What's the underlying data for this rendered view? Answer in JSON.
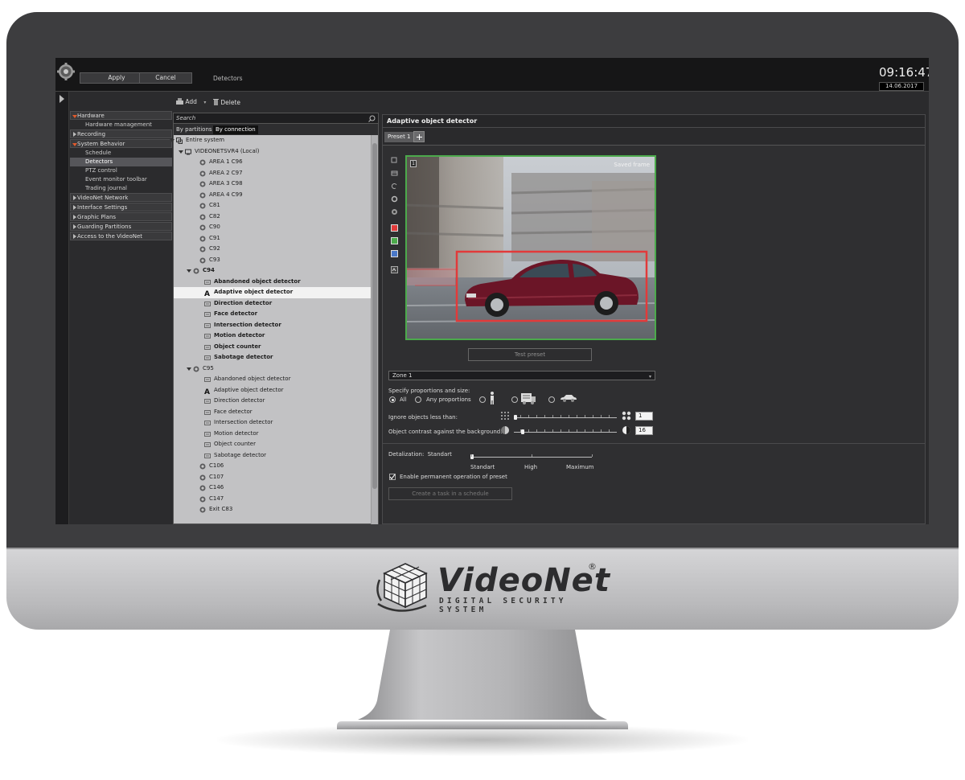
{
  "topbar": {
    "apply_label": "Apply",
    "cancel_label": "Cancel",
    "page_title": "Detectors",
    "time": "09:16:47",
    "date": "14.06.2017"
  },
  "nav": {
    "hardware": "Hardware",
    "hardware_management": "Hardware management",
    "recording": "Recording",
    "system_behavior": "System Behavior",
    "schedule": "Schedule",
    "detectors": "Detectors",
    "ptz_control": "PTZ control",
    "event_monitor_toolbar": "Event monitor toolbar",
    "trading_journal": "Trading journal",
    "videonet_network": "VideoNet Network",
    "interface_settings": "Interface Settings",
    "graphic_plans": "Graphic Plans",
    "guarding_partitions": "Guarding Partitions",
    "access": "Access to the VideoNet"
  },
  "toolbar": {
    "add_label": "Add",
    "delete_label": "Delete"
  },
  "tree_panel": {
    "search_placeholder": "Search",
    "tab_partitions": "By partitions",
    "tab_connection": "By connection",
    "entire_system": "Entire system",
    "server": "VIDEONETSVR4 (Local)",
    "cameras_a": [
      "AREA 1 C96",
      "AREA 2 C97",
      "AREA 3 C98",
      "AREA 4 C99",
      "C81",
      "C82",
      "C90",
      "C91",
      "C92",
      "C93"
    ],
    "c94": "C94",
    "c94_detectors": [
      "Abandoned object detector",
      "Adaptive object detector",
      "Direction detector",
      "Face detector",
      "Intersection detector",
      "Motion detector",
      "Object counter",
      "Sabotage detector"
    ],
    "c95": "C95",
    "c95_detectors": [
      "Abandoned object detector",
      "Adaptive object detector",
      "Direction detector",
      "Face detector",
      "Intersection detector",
      "Motion detector",
      "Object counter",
      "Sabotage detector"
    ],
    "cameras_b": [
      "C106",
      "C107",
      "C146",
      "C147",
      "Exit C83"
    ]
  },
  "detector_panel": {
    "title": "Adaptive object detector",
    "preset_tab": "Preset 1",
    "frame_number": "1",
    "saved_frame": "Saved frame",
    "test_preset": "Test preset",
    "zone": "Zone 1",
    "proportions_label": "Specify proportions and size:",
    "radio_all": "All",
    "radio_any": "Any proportions",
    "ignore_label": "Ignore objects less than:",
    "ignore_value": "1",
    "contrast_label": "Object contrast against the background:",
    "contrast_value": "16",
    "detalization_label": "Detalization:",
    "detalization_value": "Standart",
    "level_standart": "Standart",
    "level_high": "High",
    "level_maximum": "Maximum",
    "enable_label": "Enable permanent operation of preset",
    "enable_checked": true,
    "create_task": "Create a task in a schedule"
  },
  "brand": {
    "name": "VideoNet",
    "registered": "®",
    "tagline": "DIGITAL SECURITY SYSTEM"
  },
  "colors": {
    "accent_orange": "#e05a2c",
    "frame_green": "#4caa4c",
    "detection_red": "#e23a3a"
  }
}
